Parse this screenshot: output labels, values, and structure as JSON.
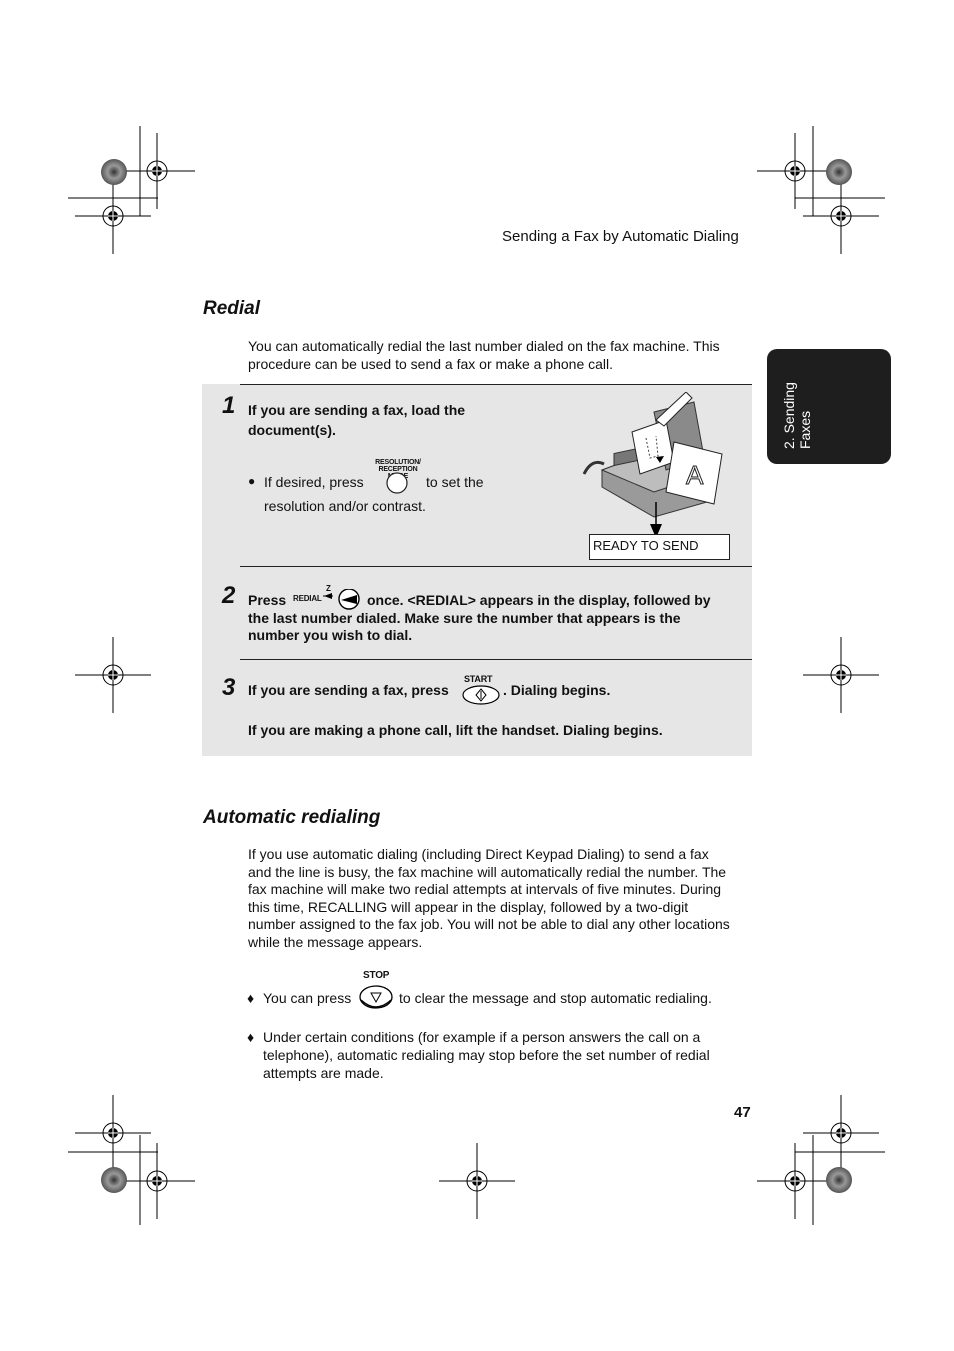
{
  "header": {
    "running_title": "Sending a Fax by Automatic Dialing"
  },
  "side_tab": {
    "line1": "2. Sending",
    "line2": "Faxes"
  },
  "redial": {
    "title": "Redial",
    "intro_line1": "You can automatically redial the last number dialed on the fax machine. This",
    "intro_line2": "procedure can be used to send a fax or make a phone call.",
    "steps": [
      {
        "number": "1",
        "text_line1": "If you are sending a fax, load the",
        "text_line2": "document(s).",
        "bullet_prefix": "If desired, press",
        "bullet_button_label_line1": "RESOLUTION/",
        "bullet_button_label_line2": "RECEPTION MODE",
        "bullet_suffix": "to set the",
        "bullet_line2": "resolution and/or contrast.",
        "display": "READY TO SEND",
        "illustration": "fax-machine-loading-document"
      },
      {
        "number": "2",
        "prefix": "Press",
        "button_label": "REDIAL",
        "button_key": "Z",
        "text_line1": "once. <REDIAL> appears in the display, followed by",
        "text_line2": "the last number dialed. Make sure the number that appears is the",
        "text_line3": "number you wish to dial."
      },
      {
        "number": "3",
        "prefix": "If you are sending a fax, press",
        "button_label": "START",
        "suffix": ". Dialing begins.",
        "text_line2": "If you are making a phone call, lift the handset. Dialing begins."
      }
    ]
  },
  "auto_redial": {
    "title": "Automatic redialing",
    "paragraph": [
      "If you use automatic dialing (including Direct Keypad Dialing) to send a fax",
      "and the line is busy, the fax machine will automatically redial the number. The",
      "fax machine will make two redial attempts at intervals of five minutes. During",
      "this time, RECALLING will appear in the display, followed by a two-digit",
      "number assigned to the fax job. You will not be able to dial any other locations",
      "while the message appears."
    ],
    "bullet1_prefix": "You can press",
    "bullet1_button_label": "STOP",
    "bullet1_suffix": "to clear the message and stop automatic redialing.",
    "bullet2": [
      "Under certain conditions (for example if a person answers the call on a",
      "telephone), automatic redialing may stop before the set number of redial",
      "attempts are made."
    ],
    "bullet_glyph": "♦"
  },
  "page_number": "47"
}
